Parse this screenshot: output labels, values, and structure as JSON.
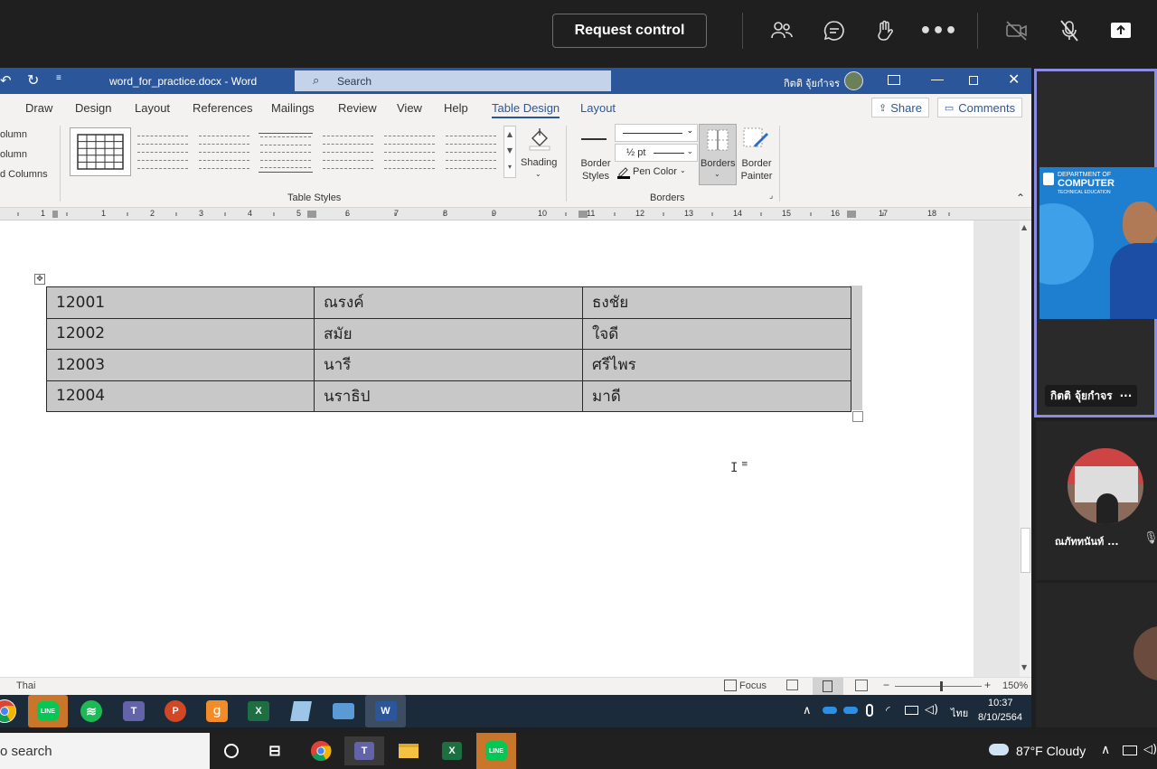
{
  "meeting": {
    "request_control_label": "Request control",
    "icons": [
      "people-icon",
      "chat-icon",
      "raise-hand-icon",
      "more-icon",
      "camera-off-icon",
      "mic-off-icon",
      "share-icon"
    ]
  },
  "word": {
    "title": "word_for_practice.docx - Word",
    "search_placeholder": "Search",
    "user_name": "กิตติ จุ้ยกำจร",
    "tabs": [
      "Draw",
      "Design",
      "Layout",
      "References",
      "Mailings",
      "Review",
      "View",
      "Help",
      "Table Design",
      "Layout"
    ],
    "active_tab": "Table Design",
    "share_label": "Share",
    "comments_label": "Comments",
    "left_options": [
      "olumn",
      "olumn",
      "d Columns"
    ],
    "shading_label": "Shading",
    "border_styles_label": "Border Styles",
    "pen_weight": "½ pt",
    "pen_color_label": "Pen Color",
    "borders_label": "Borders",
    "border_painter_label": "Border Painter",
    "group_table_styles": "Table Styles",
    "group_borders": "Borders",
    "ruler_numbers": [
      "1",
      "1",
      "2",
      "3",
      "4",
      "5",
      "6",
      "7",
      "8",
      "9",
      "10",
      "11",
      "12",
      "13",
      "14",
      "15",
      "16",
      "17",
      "18"
    ],
    "table": [
      [
        "12001",
        "ณรงค์",
        "ธงชัย"
      ],
      [
        "12002",
        "สมัย",
        "ใจดี"
      ],
      [
        "12003",
        "นารี",
        "ศรีไพร"
      ],
      [
        "12004",
        "นราธิป",
        "มาดี"
      ]
    ],
    "status_language": "Thai",
    "focus_label": "Focus",
    "zoom": "150%"
  },
  "remote_taskbar": {
    "apps": [
      "chrome",
      "line",
      "spotify",
      "teams",
      "powerpoint",
      "pdf",
      "excel",
      "notepad",
      "rdp",
      "word"
    ],
    "time": "10:37",
    "date": "8/10/2564",
    "lang": "ไทย"
  },
  "participants": {
    "presenter_name": "กิตติ จุ้ยกำจร",
    "presenter_more": "···",
    "bg_text_1": "DEPARTMENT OF",
    "bg_text_2": "COMPUTER",
    "bg_text_3": "TECHNICAL EDUCATION",
    "second_name": "ณภัททนันท์ ..."
  },
  "windows_taskbar": {
    "search_text": "o search",
    "weather": "87°F  Cloudy",
    "colors": {
      "teams": "#6264a7",
      "excel": "#1d6f42",
      "line": "#06c755"
    }
  }
}
